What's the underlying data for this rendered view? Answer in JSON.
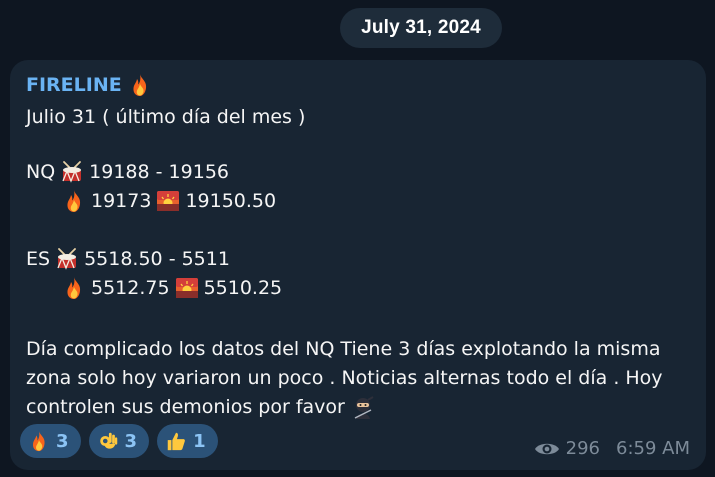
{
  "date_divider": "July 31, 2024",
  "message": {
    "sender": "FIRELINE",
    "lines": {
      "title": "Julio 31 ( último día del mes )",
      "nq_range": "19188 - 19156",
      "nq_label": "NQ",
      "nq_fire_value": "19173",
      "nq_sunrise_value": "19150.50",
      "es_label": "ES",
      "es_range": "5518.50 - 5511",
      "es_fire_value": "5512.75",
      "es_sunrise_value": "5510.25",
      "body": "Día complicado los datos del NQ Tiene 3 días explotando la misma zona solo hoy variaron un poco . Noticias alternas todo el día . Hoy controlen sus demonios por favor"
    },
    "reactions": [
      {
        "icon": "fire-icon",
        "count": "3"
      },
      {
        "icon": "ok-hand-icon",
        "count": "3"
      },
      {
        "icon": "thumbs-up-icon",
        "count": "1"
      }
    ],
    "views": "296",
    "time": "6:59 AM"
  },
  "colors": {
    "background": "#0e1621",
    "bubble": "#182533",
    "sender": "#6ab3f3",
    "reaction_bg": "#2b5278",
    "meta": "#7d8b99"
  }
}
